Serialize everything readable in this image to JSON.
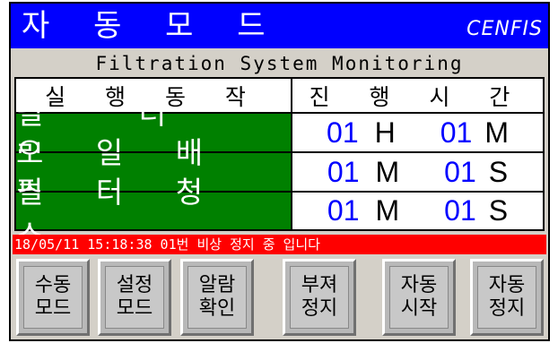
{
  "header": {
    "title": "자 동 모 드",
    "brand": "CENFIS"
  },
  "subtitle": "Filtration System Monitoring",
  "table": {
    "headers": [
      "실 행 동 작",
      "진 행 시 간"
    ],
    "rows": [
      {
        "action": "필 터 링",
        "t1_value": "01",
        "t1_unit": "H",
        "t2_value": "01",
        "t2_unit": "M"
      },
      {
        "action": "오 일 배 출",
        "t1_value": "01",
        "t1_unit": "M",
        "t2_value": "01",
        "t2_unit": "S"
      },
      {
        "action": "필 터 청 소",
        "t1_value": "01",
        "t1_unit": "M",
        "t2_value": "01",
        "t2_unit": "S"
      }
    ]
  },
  "status": {
    "message": "18/05/11 15:18:38 01번 비상 정지 중 입니다"
  },
  "buttons": [
    {
      "line1": "수동",
      "line2": "모드"
    },
    {
      "line1": "설정",
      "line2": "모드"
    },
    {
      "line1": "알람",
      "line2": "확인"
    },
    {
      "line1": "부져",
      "line2": "정지"
    },
    {
      "line1": "자동",
      "line2": "시작"
    },
    {
      "line1": "자동",
      "line2": "정지"
    }
  ],
  "colors": {
    "title_bar": "#0000ff",
    "action_cell": "#008000",
    "time_value": "#0000ff",
    "status_bar": "#ff0000"
  }
}
